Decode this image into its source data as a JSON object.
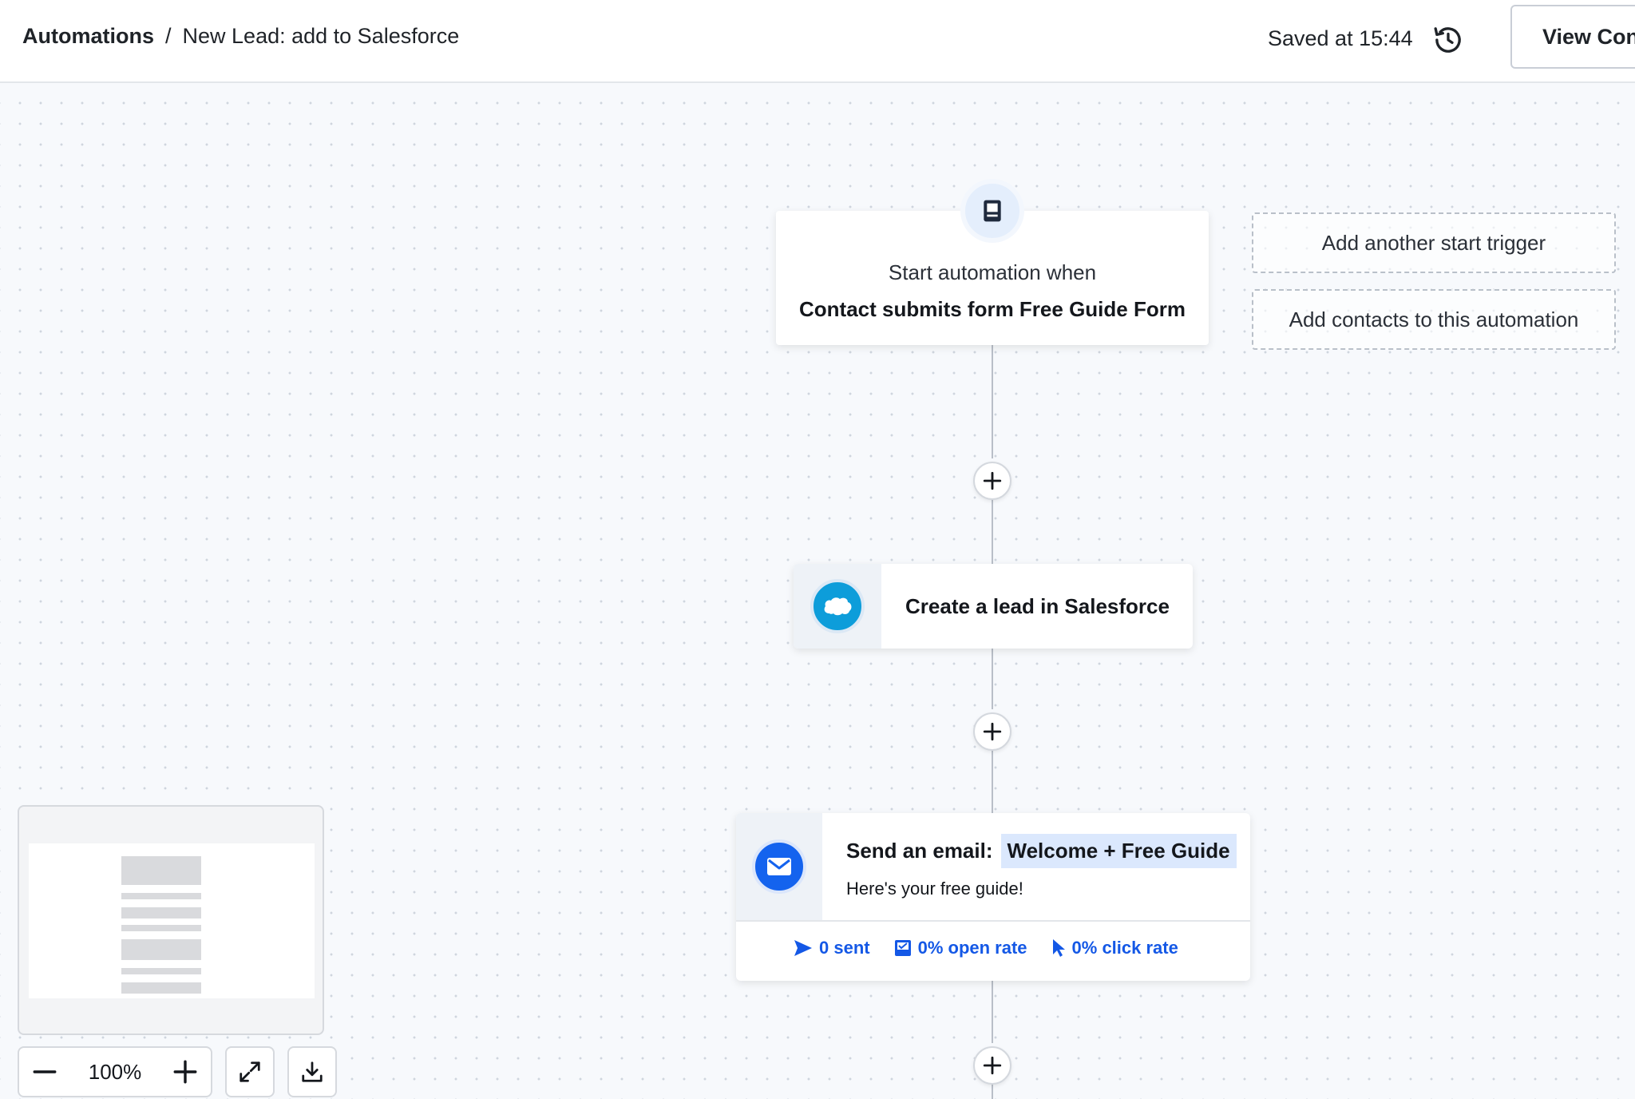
{
  "header": {
    "breadcrumb_root": "Automations",
    "breadcrumb_separator": "/",
    "breadcrumb_current": "New Lead: add to Salesforce",
    "saved_status": "Saved at 15:44",
    "history_icon": "history-icon",
    "view_button_label": "View Con"
  },
  "trigger": {
    "icon": "form-icon",
    "subtitle": "Start automation when",
    "title": "Contact submits form Free Guide Form"
  },
  "side_actions": {
    "add_trigger_label": "Add another start trigger",
    "add_contacts_label": "Add contacts to this automation"
  },
  "steps": {
    "salesforce": {
      "icon": "salesforce-icon",
      "label": "Create a lead in Salesforce"
    },
    "email": {
      "icon": "mail-icon",
      "title_prefix": "Send an email:",
      "email_name": "Welcome + Free Guide",
      "subject": "Here's your free guide!",
      "stats": {
        "sent": "0 sent",
        "open_rate": "0% open rate",
        "click_rate": "0% click rate"
      }
    }
  },
  "zoom": {
    "value": "100%"
  },
  "colors": {
    "accent_blue": "#1458e6",
    "salesforce_blue": "#0d9dda",
    "email_blue": "#1463ee",
    "highlight": "#dbe8fd"
  }
}
